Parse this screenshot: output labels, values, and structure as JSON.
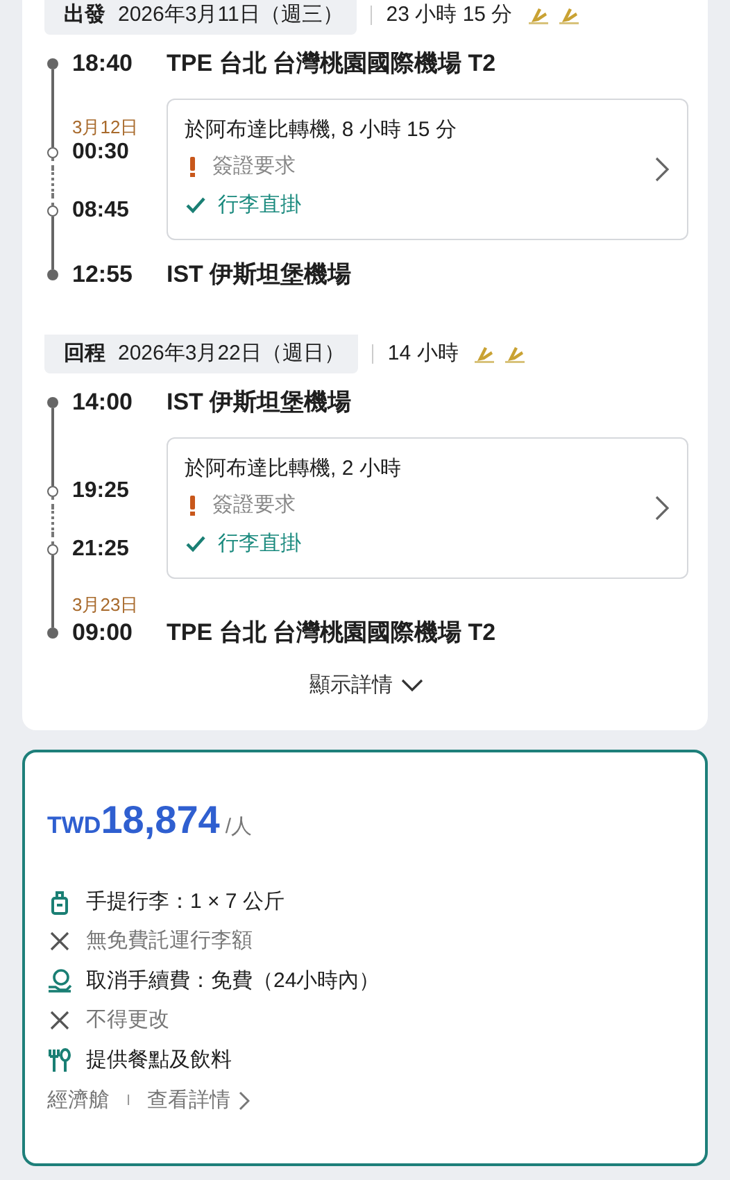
{
  "legs": [
    {
      "label": "出發",
      "date": "2026年3月11日（週三）",
      "duration": "23 小時 15 分",
      "departure": {
        "time": "18:40",
        "airport": "TPE 台北 台灣桃園國際機場 T2"
      },
      "layover": {
        "arrive_date": "3月12日",
        "arrive_time": "00:30",
        "depart_time": "08:45",
        "title": "於阿布達比轉機, 8 小時 15 分",
        "notes": [
          {
            "kind": "warning",
            "text": "簽證要求"
          },
          {
            "kind": "ok",
            "text": "行李直掛"
          }
        ]
      },
      "arrival": {
        "time": "12:55",
        "airport": "IST 伊斯坦堡機場"
      }
    },
    {
      "label": "回程",
      "date": "2026年3月22日（週日）",
      "duration": "14 小時",
      "departure": {
        "time": "14:00",
        "airport": "IST 伊斯坦堡機場"
      },
      "layover": {
        "arrive_time": "19:25",
        "depart_time": "21:25",
        "title": "於阿布達比轉機, 2 小時",
        "notes": [
          {
            "kind": "warning",
            "text": "簽證要求"
          },
          {
            "kind": "ok",
            "text": "行李直掛"
          }
        ]
      },
      "arrival": {
        "date": "3月23日",
        "time": "09:00",
        "airport": "TPE 台北 台灣桃園國際機場 T2"
      }
    }
  ],
  "details_toggle": "顯示詳情",
  "fare": {
    "currency": "TWD",
    "amount": "18,874",
    "unit": "/人",
    "features": [
      {
        "kind": "carry_on",
        "text": "手提行李：1 × 7 公斤"
      },
      {
        "kind": "excluded",
        "text": "無免費託運行李額"
      },
      {
        "kind": "refund",
        "text": "取消手續費：免費（24小時內）"
      },
      {
        "kind": "excluded",
        "text": "不得更改"
      },
      {
        "kind": "meal",
        "text": "提供餐點及飲料"
      }
    ],
    "cabin": "經濟艙",
    "separator": "I",
    "details_link": "查看詳情"
  }
}
